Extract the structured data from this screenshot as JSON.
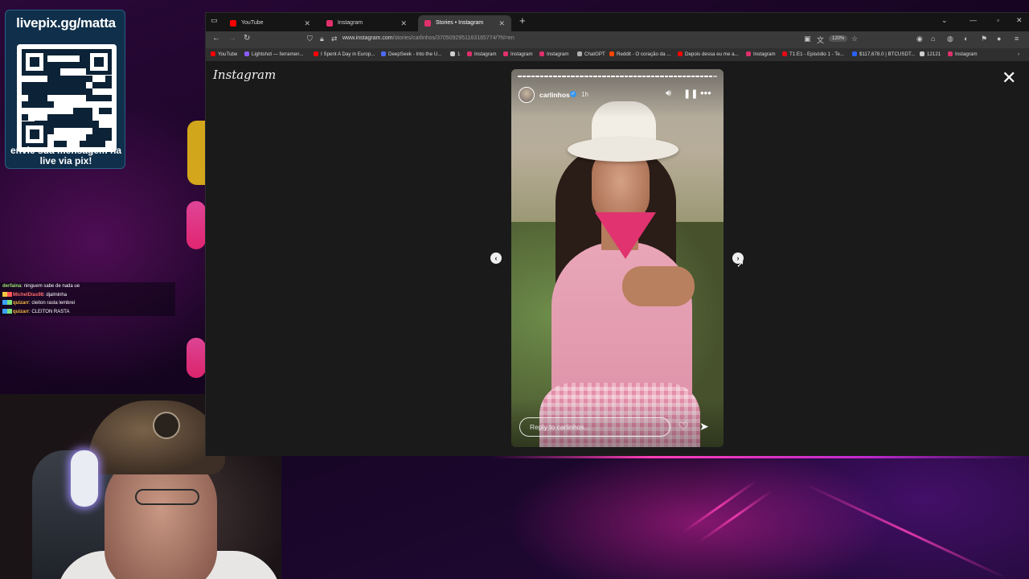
{
  "overlay": {
    "donation_url": "livepix.gg/matta",
    "donation_caption": "envie sua mensagem na live via pix!",
    "chat": [
      {
        "user": "derfaina",
        "message": ": ninguem sabe de nada ue",
        "user_color": "#9be36f"
      },
      {
        "user": "MichelDias98",
        "message": ": djalminha",
        "user_color": "#ff6b6b"
      },
      {
        "user": "quizarr",
        "message": ": cleiton rasta lembrei",
        "user_color": "#f5b942"
      },
      {
        "user": "quizarr",
        "message": ": CLEITON RASTA",
        "user_color": "#f5b942"
      }
    ]
  },
  "browser": {
    "tabs": [
      {
        "label": "YouTube",
        "favicon_color": "#ff0000",
        "active": false
      },
      {
        "label": "Instagram",
        "favicon_color": "#e1306c",
        "active": false
      },
      {
        "label": "Stories • Instagram",
        "favicon_color": "#e1306c",
        "active": true
      }
    ],
    "url_domain": "www.instagram.com",
    "url_path": "/stories/carlinhos/3705092951163165774/?hl=en",
    "zoom": "120%",
    "bookmarks": [
      {
        "label": "YouTube",
        "color": "#ff0000"
      },
      {
        "label": "Lightshot — ferramen...",
        "color": "#8a5cff"
      },
      {
        "label": "I Spent A Day in Europ...",
        "color": "#ff0000"
      },
      {
        "label": "DeepSeek - Into the U...",
        "color": "#4d6bfe"
      },
      {
        "label": "1",
        "color": "#cfcfcf"
      },
      {
        "label": "Instagram",
        "color": "#e1306c"
      },
      {
        "label": "Instagram",
        "color": "#e1306c"
      },
      {
        "label": "Instagram",
        "color": "#e1306c"
      },
      {
        "label": "ChatGPT",
        "color": "#b0b0b0"
      },
      {
        "label": "Reddit - O coração da ...",
        "color": "#ff4500"
      },
      {
        "label": "Depois dessa eu me a...",
        "color": "#ff0000"
      },
      {
        "label": "Instagram",
        "color": "#e1306c"
      },
      {
        "label": "T1:E1 - Episódio 1 - Te...",
        "color": "#e50914"
      },
      {
        "label": "$117,678.0 | BTCUSDT...",
        "color": "#2962ff"
      },
      {
        "label": "12121",
        "color": "#cfcfcf"
      },
      {
        "label": "Instagram",
        "color": "#e1306c"
      }
    ]
  },
  "instagram": {
    "logo": "Instagram",
    "story": {
      "username": "carlinhos",
      "time_ago": "1h",
      "reply_placeholder": "Reply to carlinhos...",
      "progress_segments": 45,
      "progress_done": 44
    },
    "icons": {
      "close": "close-icon",
      "prev": "chevron-left-icon",
      "next": "chevron-right-icon",
      "mute": "speaker-icon",
      "pause": "pause-icon",
      "more": "more-icon",
      "like": "heart-icon",
      "share": "send-icon"
    }
  }
}
